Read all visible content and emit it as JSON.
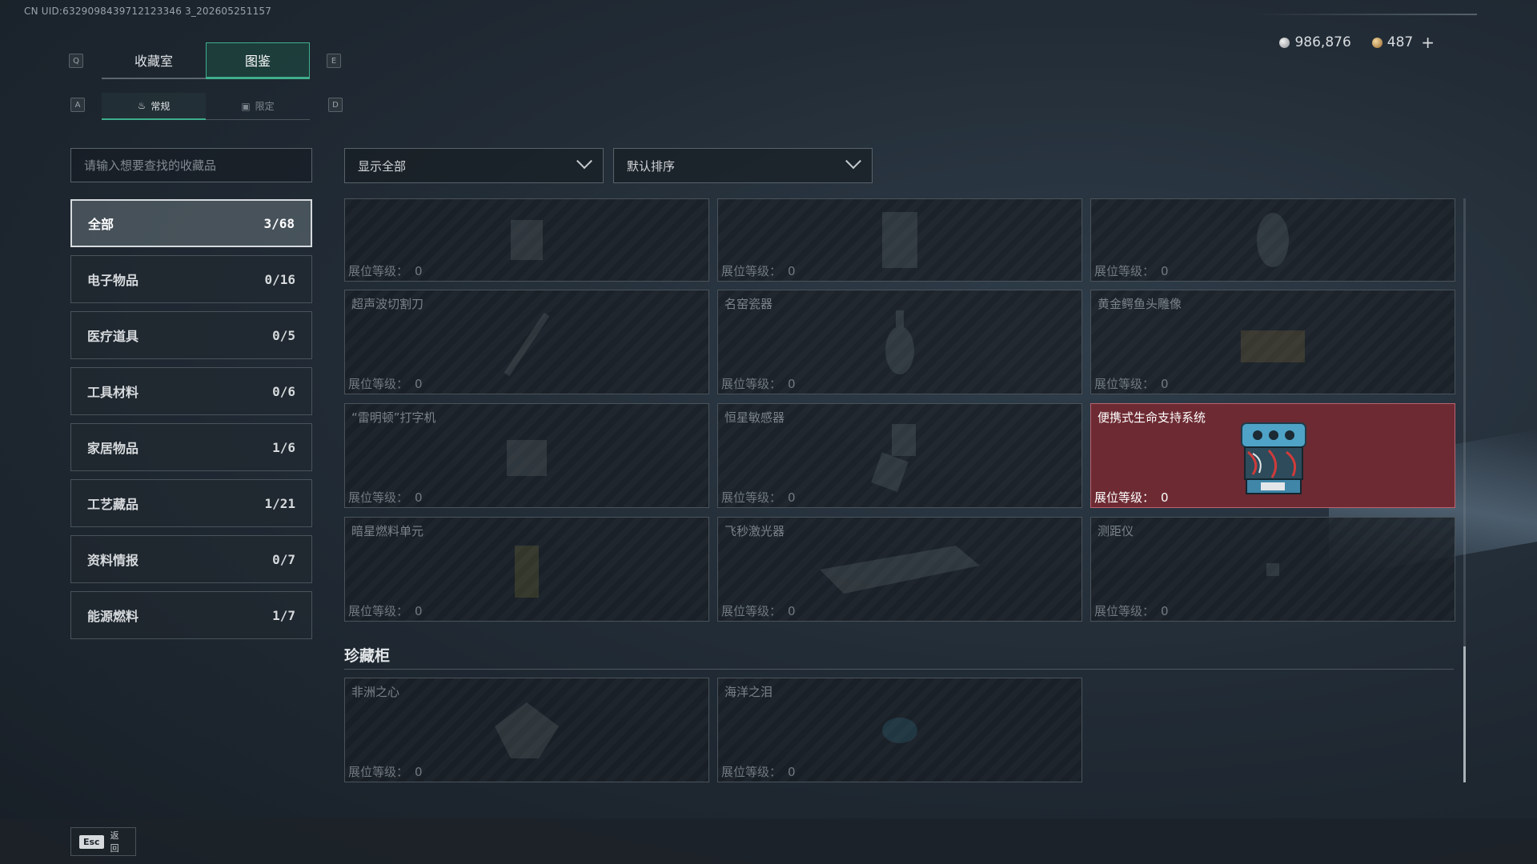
{
  "uid": "CN UID:6329098439712123346 3_202605251157",
  "currency": {
    "silver": "986,876",
    "gold": "487",
    "plus": "+"
  },
  "keys": {
    "left_main": "Q",
    "right_main": "E",
    "left_sub": "A",
    "right_sub": "D"
  },
  "main_tabs": [
    {
      "label": "收藏室"
    },
    {
      "label": "图鉴"
    }
  ],
  "sub_tabs": [
    {
      "label": "常规"
    },
    {
      "label": "限定"
    }
  ],
  "search": {
    "placeholder": "请输入想要查找的收藏品"
  },
  "categories": [
    {
      "label": "全部",
      "count": "3/68"
    },
    {
      "label": "电子物品",
      "count": "0/16"
    },
    {
      "label": "医疗道具",
      "count": "0/5"
    },
    {
      "label": "工具材料",
      "count": "0/6"
    },
    {
      "label": "家居物品",
      "count": "1/6"
    },
    {
      "label": "工艺藏品",
      "count": "1/21"
    },
    {
      "label": "资料情报",
      "count": "0/7"
    },
    {
      "label": "能源燃料",
      "count": "1/7"
    }
  ],
  "filters": {
    "show": "显示全部",
    "sort": "默认排序"
  },
  "level_label": "展位等级：",
  "items": [
    {
      "name": "",
      "level": "0"
    },
    {
      "name": "",
      "level": "0"
    },
    {
      "name": "",
      "level": "0"
    },
    {
      "name": "超声波切割刀",
      "level": "0"
    },
    {
      "name": "名窑瓷器",
      "level": "0"
    },
    {
      "name": "黄金鳄鱼头雕像",
      "level": "0"
    },
    {
      "name": "“雷明顿”打字机",
      "level": "0"
    },
    {
      "name": "恒星敏感器",
      "level": "0"
    },
    {
      "name": "便携式生命支持系统",
      "level": "0"
    },
    {
      "name": "暗星燃料单元",
      "level": "0"
    },
    {
      "name": "飞秒激光器",
      "level": "0"
    },
    {
      "name": "测距仪",
      "level": "0"
    }
  ],
  "cabinet": {
    "title": "珍藏柜",
    "items": [
      {
        "name": "非洲之心",
        "level": "0"
      },
      {
        "name": "海洋之泪",
        "level": "0"
      }
    ]
  },
  "esc": {
    "key": "Esc",
    "label": "返回"
  }
}
